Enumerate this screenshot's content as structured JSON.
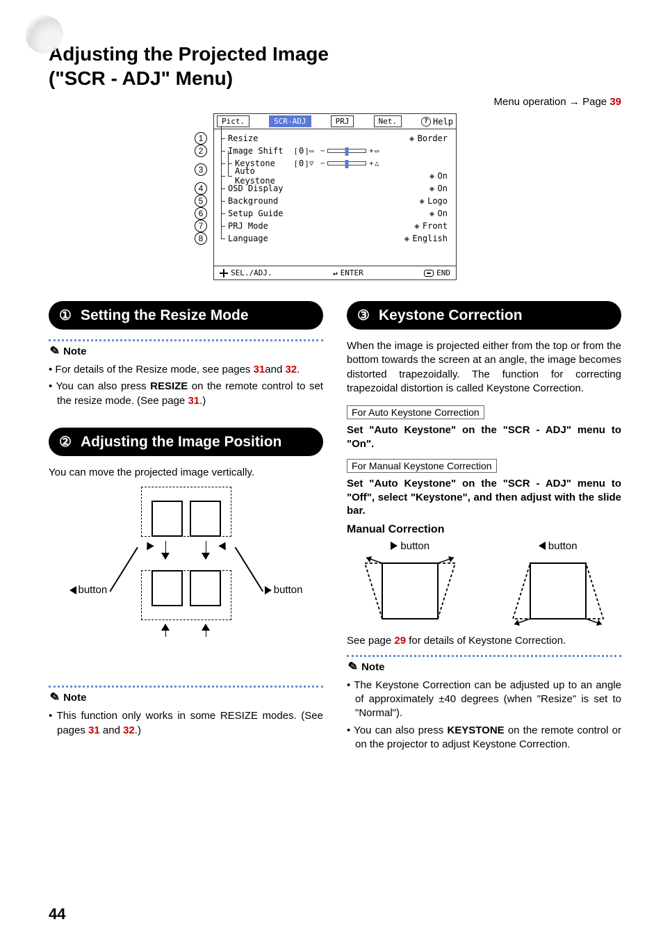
{
  "title_l1": "Adjusting the Projected Image",
  "title_l2": "(\"SCR - ADJ\" Menu)",
  "menu_op_text": "Menu operation",
  "menu_op_page_label": "Page",
  "menu_op_page": "39",
  "osd": {
    "tabs": [
      "Pict.",
      "SCR-ADJ",
      "PRJ",
      "Net.",
      "Help"
    ],
    "active_tab_index": 1,
    "rows": [
      {
        "num": "1",
        "label": "Resize",
        "type": "arrow",
        "value": "Border"
      },
      {
        "num": "2",
        "label": "Image Shift",
        "type": "slider",
        "bval": "0",
        "glyphL": "▭",
        "glyphR": "▭"
      },
      {
        "num": "3",
        "label": "Keystone",
        "type": "slider",
        "bval": "0",
        "glyphL": "▽",
        "glyphR": "△",
        "nested": true
      },
      {
        "num": "",
        "label": "Auto Keystone",
        "type": "arrow",
        "value": "On",
        "nested": true
      },
      {
        "num": "4",
        "label": "OSD Display",
        "type": "arrow",
        "value": "On"
      },
      {
        "num": "5",
        "label": "Background",
        "type": "arrow",
        "value": "Logo"
      },
      {
        "num": "6",
        "label": "Setup Guide",
        "type": "arrow",
        "value": "On"
      },
      {
        "num": "7",
        "label": "PRJ Mode",
        "type": "arrow",
        "value": "Front"
      },
      {
        "num": "8",
        "label": "Language",
        "type": "arrow",
        "value": "English"
      }
    ],
    "footer": {
      "sel": "SEL./ADJ.",
      "enter": "ENTER",
      "end": "END"
    }
  },
  "s1": {
    "num": "①",
    "title": "Setting the Resize Mode",
    "note_label": "Note",
    "n1a": "For details of the Resize mode, see pages ",
    "n1p1": "31",
    "n1and": "and ",
    "n1p2": "32",
    "n1dot": ".",
    "n2a": "You can also press ",
    "n2b": "RESIZE",
    "n2c": " on the remote control to set the resize mode. (See page ",
    "n2p": "31",
    "n2d": ".)"
  },
  "s2": {
    "num": "②",
    "title": "Adjusting the Image Position",
    "body": "You can move the projected image vertically.",
    "btn_left": "button",
    "btn_right": "button",
    "note_label": "Note",
    "n1a": "This function only works in some RESIZE modes. (See pages ",
    "n1p1": "31",
    "n1and": " and ",
    "n1p2": "32",
    "n1d": ".)"
  },
  "s3": {
    "num": "③",
    "title": "Keystone Correction",
    "body": "When the image is projected either from the top or from the bottom towards the screen at an angle, the image becomes distorted trapezoidally. The function for correcting trapezoidal distortion is called Keystone Correction.",
    "box1": "For Auto Keystone Correction",
    "instr1": "Set \"Auto Keystone\" on the \"SCR - ADJ\" menu to \"On\".",
    "box2": "For Manual Keystone Correction",
    "instr2": "Set \"Auto Keystone\" on the \"SCR - ADJ\" menu to \"Off\", select \"Keystone\", and then adjust with the slide bar.",
    "sub": "Manual Correction",
    "btn_right": "button",
    "btn_left": "button",
    "see_a": "See page ",
    "see_p": "29",
    "see_b": " for details of Keystone Correction.",
    "note_label": "Note",
    "n1": "The Keystone Correction can be adjusted up to an angle of approximately ±40 degrees (when \"Resize\" is set to \"Normal\").",
    "n2a": "You can also press ",
    "n2b": "KEYSTONE",
    "n2c": " on the remote control or on the projector to adjust Keystone Correction."
  },
  "page_number": "44"
}
